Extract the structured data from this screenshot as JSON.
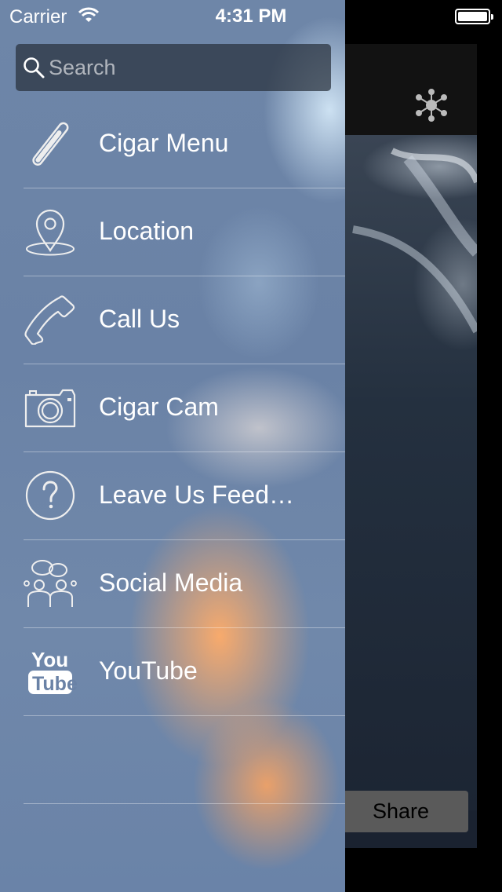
{
  "status_bar": {
    "carrier": "Carrier",
    "time": "4:31 PM"
  },
  "search": {
    "placeholder": "Search"
  },
  "menu": {
    "items": [
      {
        "label": "Cigar Menu",
        "icon": "cigar-icon"
      },
      {
        "label": "Location",
        "icon": "location-pin-icon"
      },
      {
        "label": "Call Us",
        "icon": "phone-icon"
      },
      {
        "label": "Cigar Cam",
        "icon": "camera-icon"
      },
      {
        "label": "Leave Us Feed…",
        "icon": "question-icon"
      },
      {
        "label": "Social Media",
        "icon": "people-chat-icon"
      },
      {
        "label": "YouTube",
        "icon": "youtube-icon"
      }
    ]
  },
  "content": {
    "share_label": "Share",
    "header_icon": "hub-icon"
  },
  "colors": {
    "panel_blue": "#6e86a8",
    "glow_orange": "#ffac69",
    "content_dark": "#1a2230",
    "share_button": "#5a5a5a"
  }
}
